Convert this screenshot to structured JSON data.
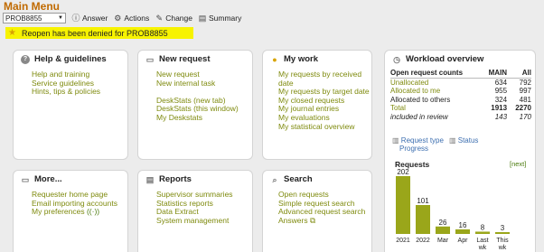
{
  "title": "Main Menu",
  "toolbar": {
    "request_select": "PROB8855",
    "answer": "Answer",
    "actions": "Actions",
    "change": "Change",
    "summary": "Summary"
  },
  "notice": "Reopen has been denied for PROB8855",
  "help": {
    "title": "Help & guidelines",
    "links": [
      "Help and training",
      "Service guidelines",
      "Hints, tips & policies"
    ]
  },
  "new_request": {
    "title": "New request",
    "links": [
      "New request",
      "New internal task"
    ],
    "links2": [
      "DeskStats (new tab)",
      "DeskStats (this window)",
      "My Deskstats"
    ]
  },
  "my_work": {
    "title": "My work",
    "links": [
      "My requests by received date",
      "My requests by target date",
      "My closed requests",
      "My journal entries",
      "My evaluations",
      "My statistical overview"
    ]
  },
  "workload": {
    "title": "Workload overview",
    "header": [
      "Open request counts",
      "MAIN",
      "All"
    ],
    "rows": [
      {
        "label": "Unallocated",
        "main": "634",
        "all": "792"
      },
      {
        "label": "Allocated to me",
        "main": "955",
        "all": "997"
      },
      {
        "label": "Allocated to others",
        "main": "324",
        "all": "481"
      },
      {
        "label": "Total",
        "main": "1913",
        "all": "2270"
      },
      {
        "label": "included in review",
        "main": "143",
        "all": "170"
      }
    ],
    "link_request_type": "Request type",
    "link_status": "Status",
    "link_progress": "Progress",
    "requests_title": "Requests",
    "next": "[next]"
  },
  "more": {
    "title": "More...",
    "links": [
      "Requester home page",
      "Email importing accounts",
      "My preferences"
    ]
  },
  "reports": {
    "title": "Reports",
    "links": [
      "Supervisor summaries",
      "Statistics reports",
      "Data Extract",
      "System management"
    ]
  },
  "search": {
    "title": "Search",
    "links": [
      "Open requests",
      "Simple request search",
      "Advanced request search",
      "Answers"
    ]
  },
  "chart_data": {
    "type": "bar",
    "title": "Requests",
    "categories": [
      "2021",
      "2022",
      "Mar",
      "Apr",
      "Last wk",
      "This wk"
    ],
    "values": [
      202,
      101,
      26,
      16,
      8,
      3
    ],
    "bar_color": "#9aa61a"
  }
}
